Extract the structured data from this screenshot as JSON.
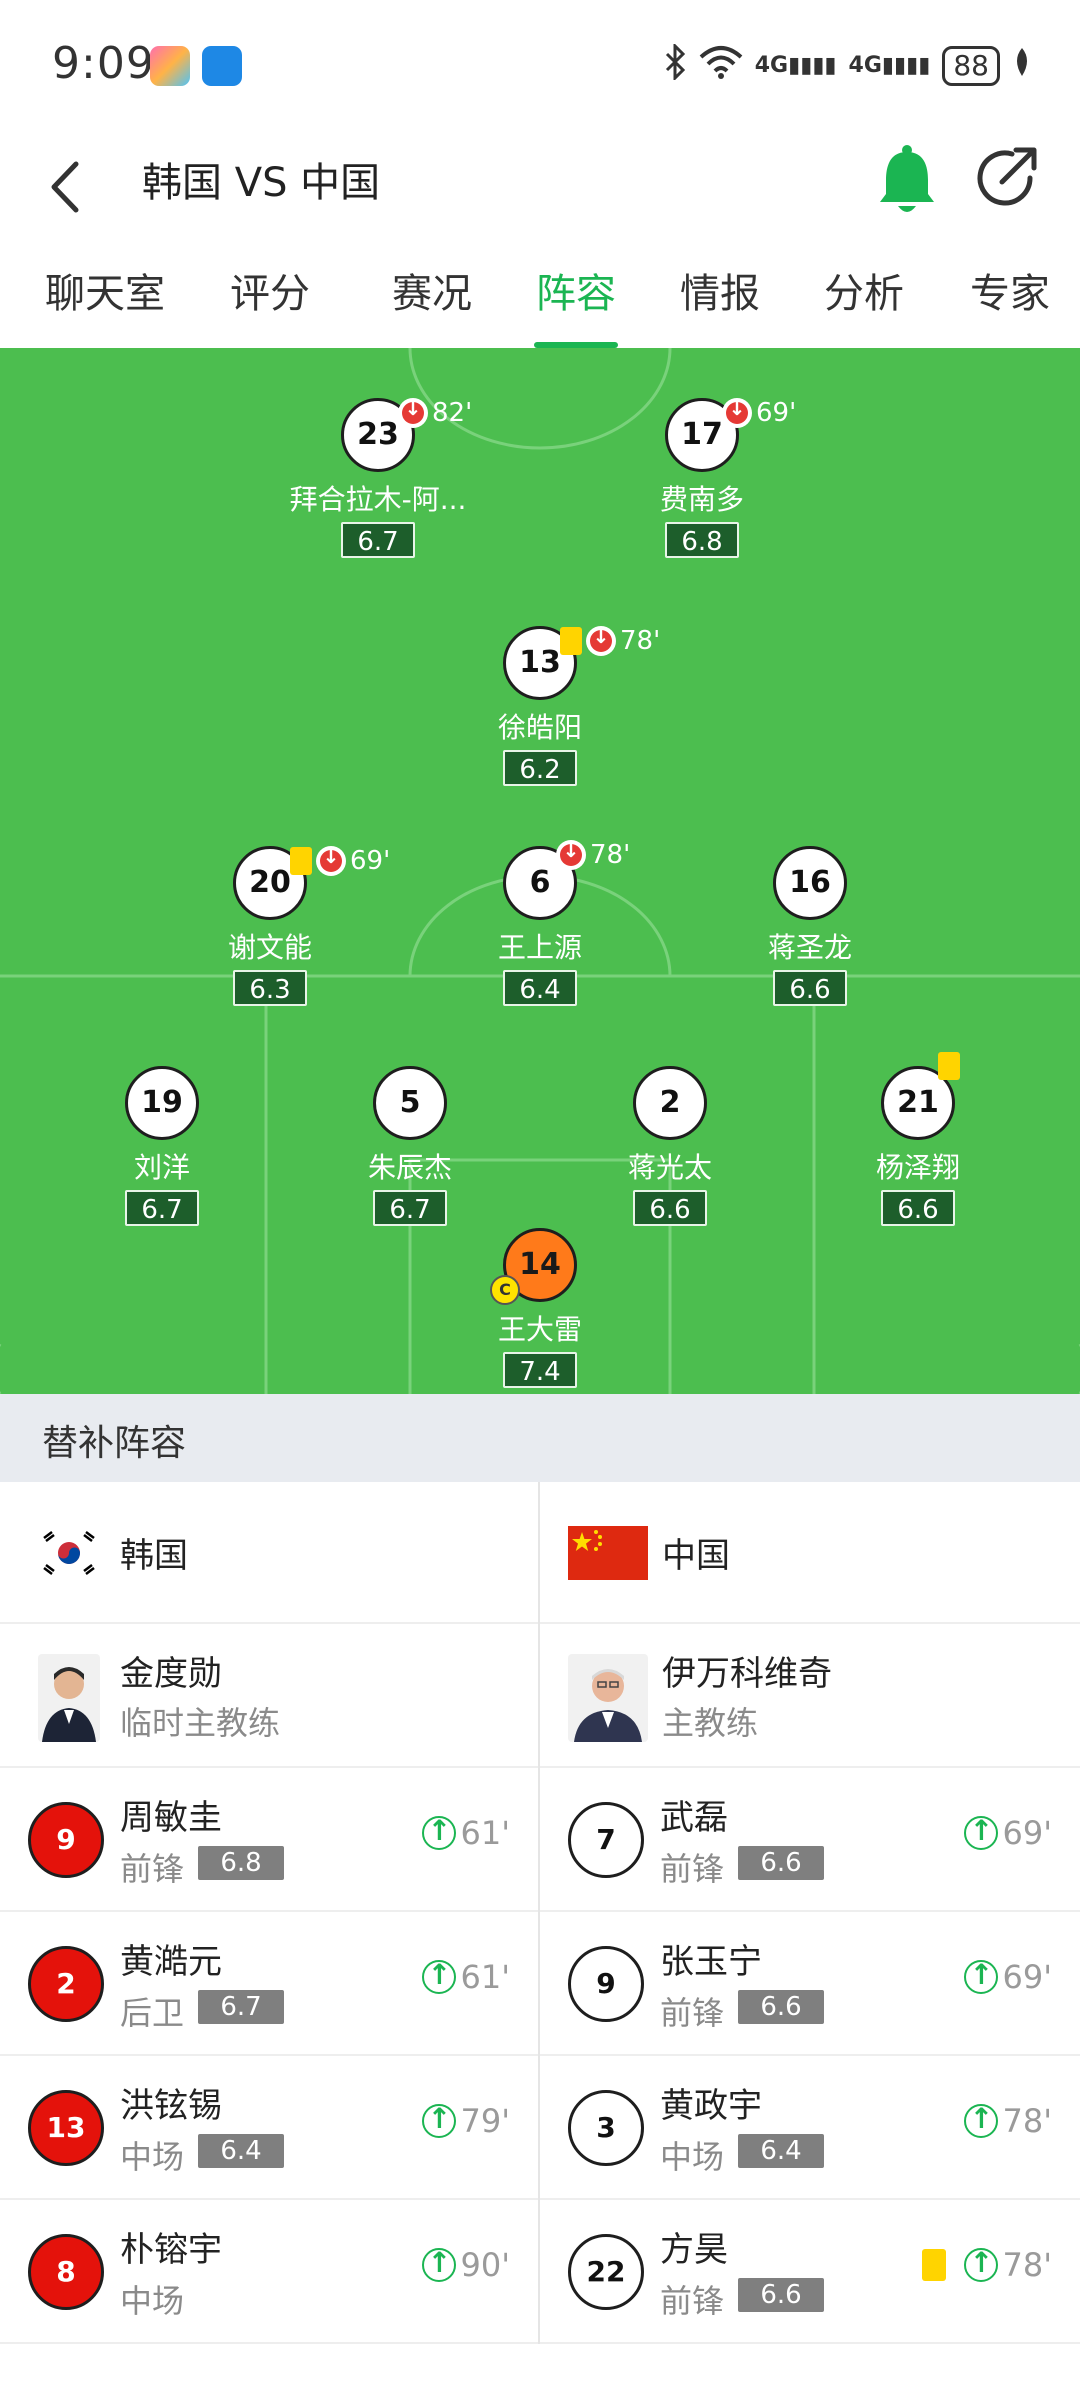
{
  "status_bar": {
    "time": "9:09",
    "network_1": "4G",
    "network_2": "4G",
    "battery": "88"
  },
  "header": {
    "title": "韩国 VS 中国",
    "back_icon": "back-icon",
    "bell_icon": "bell-icon",
    "share_icon": "share-icon"
  },
  "tabs": [
    "聊天室",
    "评分",
    "赛况",
    "阵容",
    "情报",
    "分析",
    "专家"
  ],
  "active_tab": "阵容",
  "pitch_players": [
    {
      "number": "23",
      "name": "拜合拉木-阿...",
      "rating": "6.7",
      "sub_minute": "82'"
    },
    {
      "number": "17",
      "name": "费南多",
      "rating": "6.8",
      "sub_minute": "69'"
    },
    {
      "number": "13",
      "name": "徐皓阳",
      "rating": "6.2",
      "sub_minute": "78'",
      "yellow": true
    },
    {
      "number": "20",
      "name": "谢文能",
      "rating": "6.3",
      "sub_minute": "69'",
      "yellow": true
    },
    {
      "number": "6",
      "name": "王上源",
      "rating": "6.4",
      "sub_minute": "78'"
    },
    {
      "number": "16",
      "name": "蒋圣龙",
      "rating": "6.6"
    },
    {
      "number": "19",
      "name": "刘洋",
      "rating": "6.7"
    },
    {
      "number": "5",
      "name": "朱辰杰",
      "rating": "6.7"
    },
    {
      "number": "2",
      "name": "蒋光太",
      "rating": "6.6"
    },
    {
      "number": "21",
      "name": "杨泽翔",
      "rating": "6.6",
      "yellow": true
    },
    {
      "number": "14",
      "name": "王大雷",
      "rating": "7.4",
      "captain": "C"
    }
  ],
  "substitutes": {
    "title": "替补阵容",
    "korea": {
      "team_name": "韩国",
      "coach_name": "金度勋",
      "coach_role": "临时主教练",
      "players": [
        {
          "number": "9",
          "name": "周敏圭",
          "position": "前锋",
          "rating": "6.8",
          "sub_in": "61'"
        },
        {
          "number": "2",
          "name": "黄澔元",
          "position": "后卫",
          "rating": "6.7",
          "sub_in": "61'"
        },
        {
          "number": "13",
          "name": "洪铉锡",
          "position": "中场",
          "rating": "6.4",
          "sub_in": "79'"
        },
        {
          "number": "8",
          "name": "朴镕宇",
          "position": "中场",
          "rating": "",
          "sub_in": "90'"
        }
      ]
    },
    "china": {
      "team_name": "中国",
      "coach_name": "伊万科维奇",
      "coach_role": "主教练",
      "players": [
        {
          "number": "7",
          "name": "武磊",
          "position": "前锋",
          "rating": "6.6",
          "sub_in": "69'"
        },
        {
          "number": "9",
          "name": "张玉宁",
          "position": "前锋",
          "rating": "6.6",
          "sub_in": "69'"
        },
        {
          "number": "3",
          "name": "黄政宇",
          "position": "中场",
          "rating": "6.4",
          "sub_in": "78'"
        },
        {
          "number": "22",
          "name": "方昊",
          "position": "前锋",
          "rating": "6.6",
          "sub_in": "78'",
          "yellow": true
        }
      ]
    }
  },
  "colors": {
    "accent": "#1bb552",
    "pitch": "#4cbe4f",
    "korea_red": "#e4120b",
    "goalkeeper": "#ff7a1a"
  }
}
